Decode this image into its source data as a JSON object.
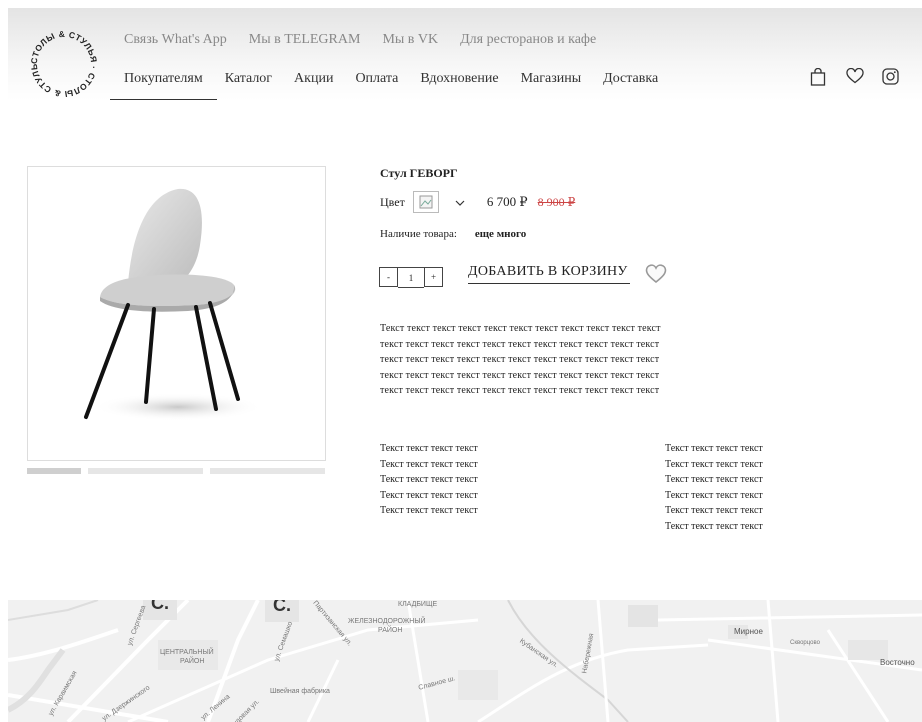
{
  "header": {
    "logo_text": "СТОЛЫ & СТУЛЬЯ · СТОЛЫ & СТУЛЬЯ ·",
    "top_links": [
      "Связь What's App",
      "Мы в TELEGRAM",
      "Мы в VK",
      "Для ресторанов и кафе"
    ],
    "main_nav": [
      "Покупателям",
      "Каталог",
      "Акции",
      "Оплата",
      "Вдохновение",
      "Магазины",
      "Доставка"
    ],
    "icons": [
      "cart-icon",
      "heart-icon",
      "instagram-icon"
    ]
  },
  "product": {
    "title": "Стул ГЕВОРГ",
    "color_label": "Цвет",
    "price": "6 700 ₽",
    "old_price": "8 900 ₽",
    "availability_label": "Наличие товара:",
    "availability_value": "еще много",
    "qty_minus": "-",
    "qty_value": "1",
    "qty_plus": "+",
    "add_to_cart": "ДОБАВИТЬ В КОРЗИНУ",
    "description_lines": [
      "Текст текст текст текст текст текст текст текст текст текст текст",
      "текст текст текст текст текст текст текст текст текст текст текст",
      "текст текст текст текст текст текст текст текст текст текст текст",
      "текст текст текст текст текст текст текст текст текст текст текст",
      "текст текст текст текст текст текст текст текст текст текст текст"
    ],
    "specs_left": [
      "Текст текст текст текст",
      "Текст текст текст текст",
      "Текст текст текст текст",
      "Текст текст текст текст",
      "Текст текст текст текст"
    ],
    "specs_right": [
      "Текст текст текст текст",
      "Текст текст текст текст",
      "Текст текст текст текст",
      "Текст текст текст текст",
      "Текст текст текст текст",
      "Текст текст текст текст"
    ]
  },
  "map": {
    "labels": [
      "КЛАДБИЩЕ",
      "ЖЕЛЕЗНОДОРОЖНЫЙ",
      "РАЙОН",
      "ЦЕНТРАЛЬНЫЙ",
      "РАЙОН",
      "Швейная фабрика",
      "Мирное",
      "Скворцово",
      "Восточно",
      "ул. Ленина",
      "ул. Дзержинского",
      "ул. Сергеева",
      "Кубанская ул.",
      "Славное ш.",
      "Партизанская ул.",
      "ул. Караимская",
      "Набережная",
      "ул. Семашко",
      "Трудовая ул."
    ],
    "marker_letter": "С."
  },
  "colors": {
    "accent": "#333333",
    "old_price": "#cc4444",
    "map_bg": "#f1f1f1"
  }
}
